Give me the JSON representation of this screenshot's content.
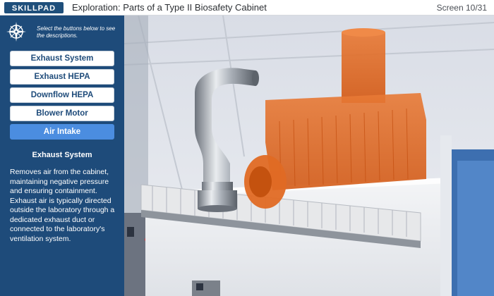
{
  "app": {
    "logo_text": "SKILLPAD",
    "title": "Exploration: Parts of a Type II Biosafety Cabinet",
    "screen_counter": "Screen 10/31"
  },
  "sidebar": {
    "instruction": "Select the buttons below to see the descriptions.",
    "buttons": [
      {
        "label": "Exhaust System"
      },
      {
        "label": "Exhaust HEPA"
      },
      {
        "label": "Downflow HEPA"
      },
      {
        "label": "Blower Motor"
      },
      {
        "label": "Air Intake"
      }
    ],
    "active_button": "Air Intake"
  },
  "description": {
    "title": "Exhaust System",
    "body": "Removes air from the cabinet, maintaining negative pressure and ensuring containment. Exhaust air is typically directed outside the laboratory through a dedicated exhaust duct or connected to the laboratory's ventilation system."
  },
  "colors": {
    "sidebar_bg": "#1e4b7a",
    "active_button": "#4b8de0",
    "highlight_orange": "#e0651f"
  },
  "icons": {
    "compass": "compass-icon"
  }
}
